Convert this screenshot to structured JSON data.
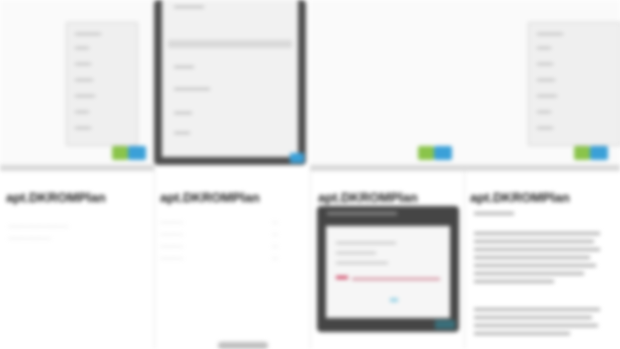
{
  "headings": [
    "apt.DKROMPlan",
    "apt.DKROMPlan",
    "apt.DKROMPlan",
    "apt.DKROMPlan"
  ],
  "captions": {
    "col1_line1": "...............................",
    "col1_line2": "......................",
    "col2_rows": [
      "............",
      "............",
      "............",
      "............"
    ],
    "col2_vals": [
      "...",
      "...",
      "...",
      "..."
    ]
  },
  "dialog": {
    "title": "..........",
    "button": ".."
  },
  "icons": [
    "app-icon-green",
    "app-icon-blue"
  ],
  "colors": {
    "green": "#8ac44a",
    "blue": "#3aa0d8",
    "frame": "#4e4e4e",
    "accent_red": "#cc3a5a"
  }
}
